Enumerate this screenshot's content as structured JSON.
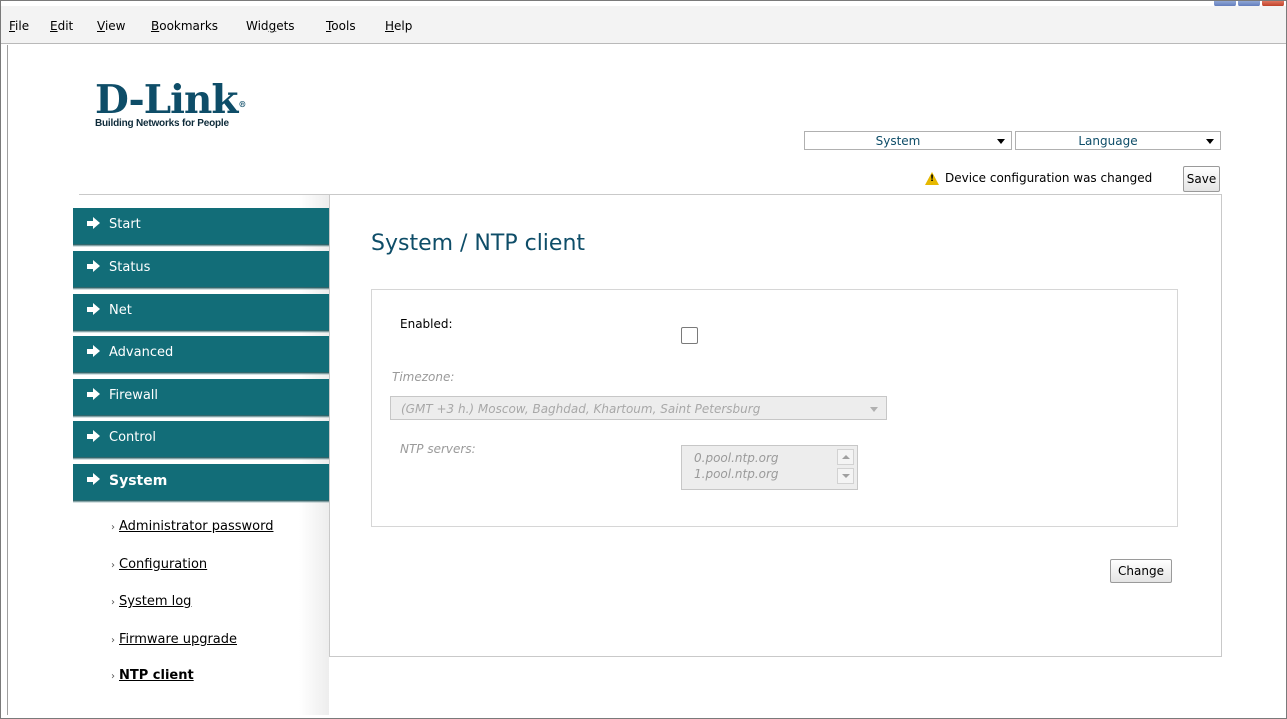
{
  "menubar": {
    "items": [
      {
        "label": "File",
        "underline": "F"
      },
      {
        "label": "Edit",
        "underline": "E"
      },
      {
        "label": "View",
        "underline": "V"
      },
      {
        "label": "Bookmarks",
        "underline": "B"
      },
      {
        "label": "Widgets",
        "underline": "g"
      },
      {
        "label": "Tools",
        "underline": "T"
      },
      {
        "label": "Help",
        "underline": "H"
      }
    ]
  },
  "logo": {
    "mark": "D-Link",
    "tagline": "Building Networks for People"
  },
  "header": {
    "system_select": "System",
    "language_select": "Language",
    "notice": "Device configuration was changed",
    "save_label": "Save"
  },
  "sidebar": {
    "items": [
      {
        "label": "Start"
      },
      {
        "label": "Status"
      },
      {
        "label": "Net"
      },
      {
        "label": "Advanced"
      },
      {
        "label": "Firewall"
      },
      {
        "label": "Control"
      },
      {
        "label": "System",
        "active": true
      }
    ],
    "subitems": [
      {
        "label": "Administrator password"
      },
      {
        "label": "Configuration"
      },
      {
        "label": "System log"
      },
      {
        "label": "Firmware upgrade"
      },
      {
        "label": "NTP client",
        "active": true
      }
    ]
  },
  "main": {
    "title": "System /  NTP client",
    "enabled_label": "Enabled:",
    "enabled_checked": false,
    "timezone_label": "Timezone:",
    "timezone_value": "(GMT +3 h.) Moscow, Baghdad, Khartoum, Saint Petersburg",
    "ntp_label": "NTP servers:",
    "ntp_servers": [
      "0.pool.ntp.org",
      "1.pool.ntp.org"
    ],
    "change_label": "Change"
  },
  "colors": {
    "accent": "#126d78",
    "brand": "#0e4d68",
    "warning": "#e6b800"
  }
}
